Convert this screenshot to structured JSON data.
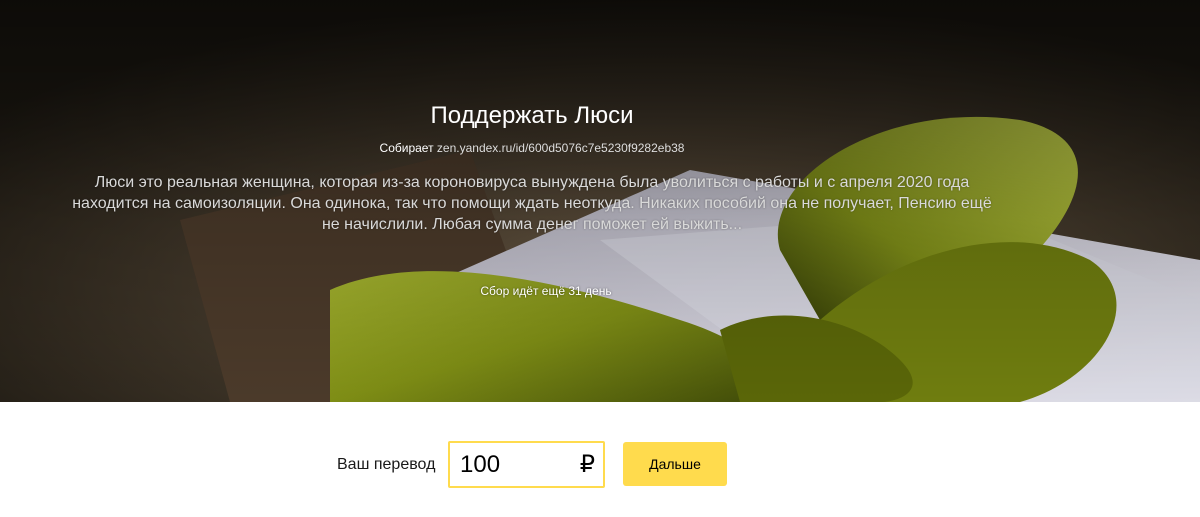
{
  "campaign": {
    "title": "Поддержать Люси",
    "collector_label": "Собирает",
    "collector_link": "zen.yandex.ru/id/600d5076c7e5230f9282eb38",
    "description": "Люси это реальная женщина, которая из-за короновируса вынуждена была уволиться с работы и с апреля 2020 года находится на самоизоляции. Она одинока, так что помощи ждать неоткуда. Никаких пособий она не получает, Пенсию ещё не начислили. Любая сумма денег поможет ей выжить...",
    "days_left": "Сбор идёт ещё  31 день"
  },
  "transfer": {
    "label": "Ваш перевод",
    "amount": "100",
    "currency_symbol": "₽",
    "next_button": "Дальше"
  },
  "colors": {
    "accent": "#ffdb4d",
    "ribbon": "#8a9a1c",
    "hero_dark": "#2a2419"
  }
}
